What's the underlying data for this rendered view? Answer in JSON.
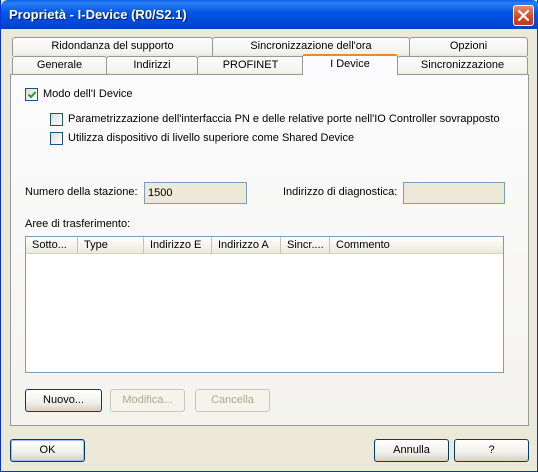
{
  "window": {
    "title": "Proprietà - I-Device (R0/S2.1)"
  },
  "tabs": {
    "row_back": [
      {
        "label": "Ridondanza del supporto"
      },
      {
        "label": "Sincronizzazione dell'ora"
      },
      {
        "label": "Opzioni"
      }
    ],
    "row_front": [
      {
        "label": "Generale"
      },
      {
        "label": "Indirizzi"
      },
      {
        "label": "PROFINET"
      },
      {
        "label": "I Device"
      },
      {
        "label": "Sincronizzazione"
      }
    ],
    "active": "I Device"
  },
  "panel": {
    "idevice_mode": {
      "label": "Modo dell'I Device",
      "checked": true
    },
    "param_pn": {
      "label": "Parametrizzazione dell'interfaccia PN e delle relative porte nell'IO Controller sovrapposto",
      "checked": false
    },
    "shared_device": {
      "label": "Utilizza dispositivo di livello superiore come Shared Device",
      "checked": false
    },
    "station_number": {
      "label": "Numero della stazione:",
      "value": "1500"
    },
    "diag_address": {
      "label": "Indirizzo di diagnostica:",
      "value": ""
    },
    "transfer_areas": {
      "label": "Aree di trasferimento:",
      "columns": [
        "Sotto...",
        "Type",
        "Indirizzo E",
        "Indirizzo A",
        "Sincr....",
        "Commento"
      ],
      "rows": []
    },
    "buttons": {
      "new": "Nuovo...",
      "edit": "Modifica...",
      "delete": "Cancella"
    }
  },
  "footer": {
    "ok": "OK",
    "cancel": "Annulla",
    "help": "?"
  }
}
